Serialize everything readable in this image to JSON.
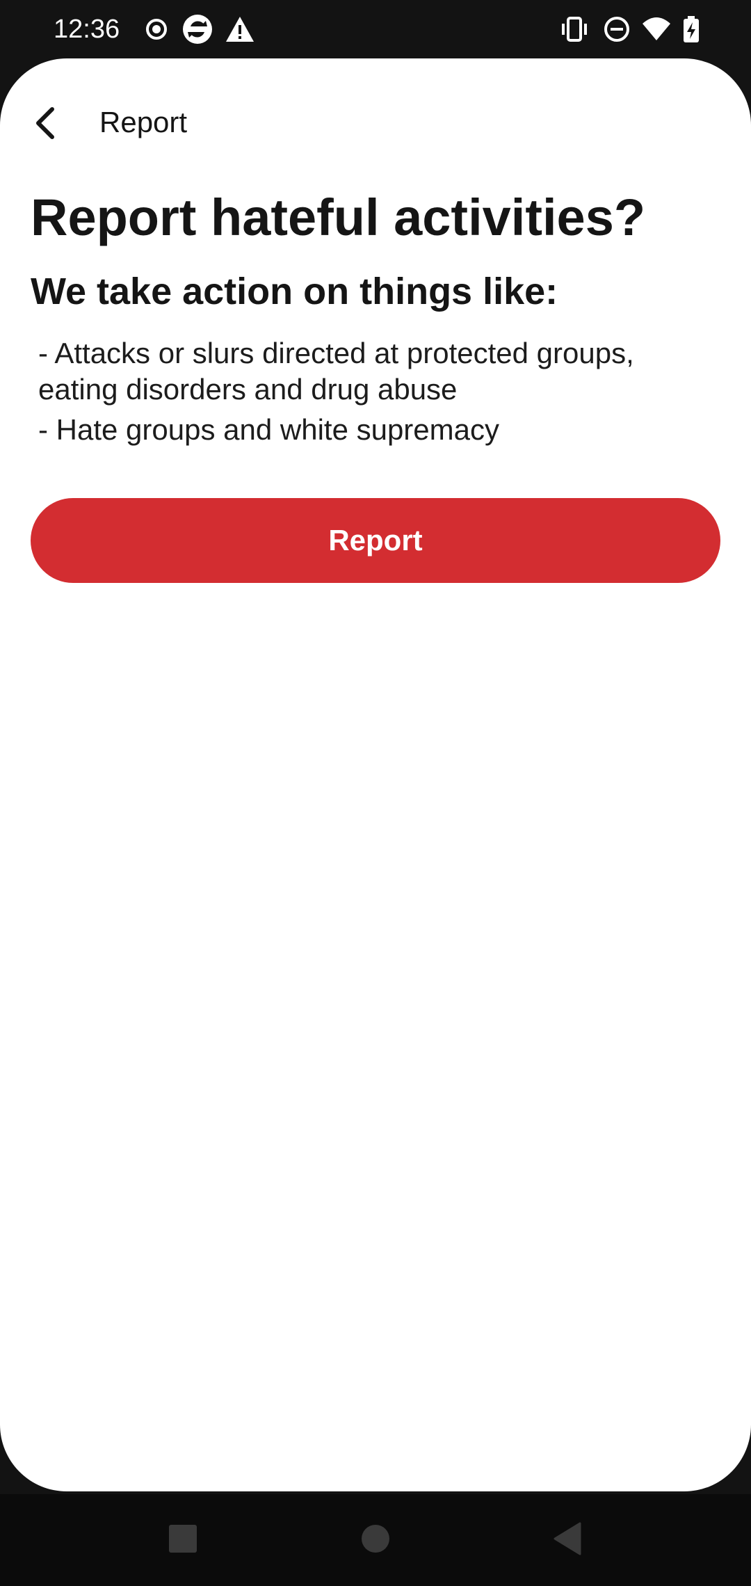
{
  "status_bar": {
    "time": "12:36",
    "left_icons": [
      "record-icon",
      "sync-icon",
      "alert-icon"
    ],
    "right_icons": [
      "vibrate-icon",
      "do-not-disturb-icon",
      "wifi-icon",
      "battery-charging-icon"
    ]
  },
  "toolbar": {
    "back_icon": "chevron-left-icon",
    "title": "Report"
  },
  "content": {
    "heading": "Report hateful activities?",
    "subheading": "We take action on things like:",
    "bullets": [
      "- Attacks or slurs directed at protected groups, eating disorders and drug abuse",
      "- Hate groups and white supremacy"
    ]
  },
  "actions": {
    "report_label": "Report"
  },
  "nav_bar": {
    "buttons": [
      "recents-square-icon",
      "home-circle-icon",
      "back-triangle-icon"
    ]
  },
  "colors": {
    "accent": "#d32d31",
    "background": "#ffffff",
    "system_bar": "#131313",
    "text": "#151515"
  }
}
